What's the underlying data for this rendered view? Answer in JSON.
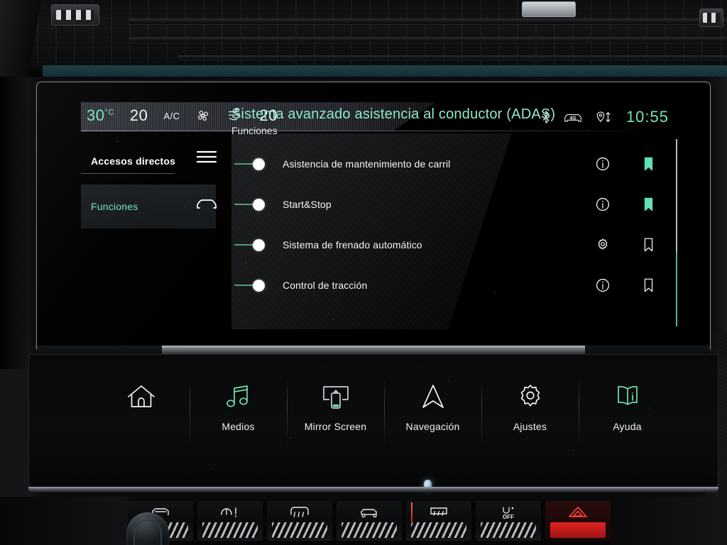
{
  "climate": {
    "outside_temp": "30",
    "outside_temp_unit": "°C",
    "driver_temp": "20",
    "ac_label": "A/C",
    "fan_icon": "fan-icon",
    "airflow_icon": "airflow-icon",
    "passenger_temp": "20"
  },
  "status": {
    "bluetooth_icon": "bluetooth-icon",
    "network_icon": "4g-connected-car-icon",
    "network_label": "4G",
    "location_icon": "location-data-transfer-icon",
    "clock": "10:55"
  },
  "sidebar": {
    "items": [
      {
        "label": "Accesos directos",
        "icon": "hamburger-menu-icon",
        "selected": false
      },
      {
        "label": "Funciones",
        "icon": "car-front-icon",
        "selected": true
      }
    ]
  },
  "main": {
    "title": "Sistema avanzado asistencia al conductor (ADAS)",
    "subtitle": "Funciones",
    "rows": [
      {
        "label": "Asistencia de mantenimiento de carril",
        "toggle": "on",
        "action_icon": "info-icon",
        "bookmark": "filled"
      },
      {
        "label": "Start&Stop",
        "toggle": "on",
        "action_icon": "info-icon",
        "bookmark": "filled"
      },
      {
        "label": "Sistema de frenado automático",
        "toggle": "on",
        "action_icon": "gear-icon",
        "bookmark": "outline"
      },
      {
        "label": "Control de tracción",
        "toggle": "on",
        "action_icon": "info-icon",
        "bookmark": "outline"
      }
    ]
  },
  "shortcuts": [
    {
      "label": "",
      "icon": "home-icon",
      "accent": "white"
    },
    {
      "label": "Medios",
      "icon": "music-note-icon",
      "accent": "green"
    },
    {
      "label": "Mirror Screen",
      "icon": "mirror-screen-icon",
      "accent": "mixed"
    },
    {
      "label": "Navegación",
      "icon": "navigation-arrow-icon",
      "accent": "white"
    },
    {
      "label": "Ajustes",
      "icon": "gear-icon",
      "accent": "white"
    },
    {
      "label": "Ayuda",
      "icon": "help-book-icon",
      "accent": "green"
    }
  ],
  "hard_buttons": [
    {
      "icon": "rear-window-defrost-icon",
      "style": "normal"
    },
    {
      "icon": "windscreen-wiper-icon",
      "style": "normal"
    },
    {
      "icon": "front-defrost-icon",
      "style": "normal"
    },
    {
      "icon": "parking-sensors-icon",
      "style": "normal"
    },
    {
      "icon": "rear-defrost-icon",
      "style": "normal"
    },
    {
      "icon": "auto-stop-off-icon",
      "style": "normal"
    },
    {
      "icon": "hazard-warning-icon",
      "style": "hazard"
    }
  ],
  "colors": {
    "accent_green": "#74e6b8",
    "text_white": "#f2f5f7",
    "screen_black": "#000000",
    "hazard_red": "#e02424"
  }
}
